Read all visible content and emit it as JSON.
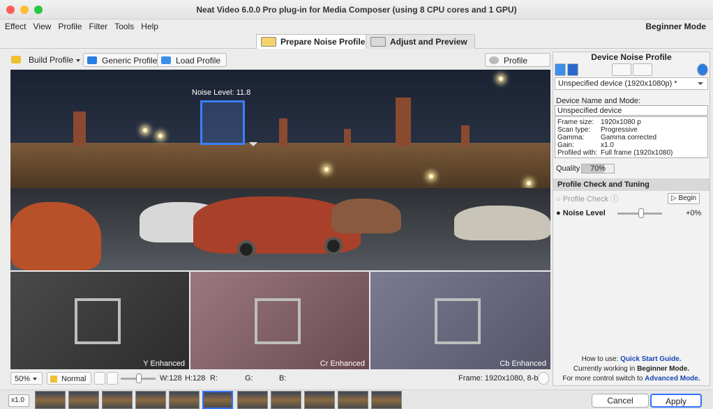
{
  "window": {
    "title": "Neat Video 6.0.0 Pro plug-in for Media Composer (using 8 CPU cores and 1 GPU)"
  },
  "menu": {
    "items": [
      "Effect",
      "View",
      "Profile",
      "Filter",
      "Tools",
      "Help"
    ],
    "mode": "Beginner Mode"
  },
  "tabs": {
    "prepare": "Prepare Noise Profile",
    "adjust": "Adjust and Preview"
  },
  "toolbar": {
    "build": "Build Profile",
    "generic": "Generic Profile",
    "load": "Load Profile",
    "check": "Profile Check"
  },
  "viewer": {
    "noise_label": "Noise Level: 11.8",
    "y_label": "Y Enhanced",
    "cr_label": "Cr Enhanced",
    "cb_label": "Cb Enhanced"
  },
  "status": {
    "zoom": "50%",
    "display": "Normal",
    "w": "W:128",
    "h": "H:128",
    "r": "R:",
    "g": "G:",
    "b": "B:",
    "frame": "Frame: 1920x1080, 8-bit"
  },
  "panel": {
    "title": "Device Noise Profile",
    "device": "Unspecified device (1920x1080p) *",
    "name_mode_label": "Device Name and Mode:",
    "device_name": "Unspecified device",
    "info": {
      "frame_size_k": "Frame size:",
      "frame_size_v": "1920x1080 p",
      "scan_k": "Scan type:",
      "scan_v": "Progressive",
      "gamma_k": "Gamma:",
      "gamma_v": "Gamma corrected",
      "gain_k": "Gain:",
      "gain_v": "x1.0",
      "profiled_k": "Profiled with:",
      "profiled_v": "Full frame (1920x1080)"
    },
    "quality_label": "Quality",
    "quality_value": "70%",
    "check_tuning_title": "Profile Check and Tuning",
    "profile_check_label": "Profile Check",
    "begin": "Begin",
    "noise_level_label": "Noise Level",
    "noise_level_value": "+0%",
    "help_line1_pre": "How to use: ",
    "help_line1_link": "Quick Start Guide.",
    "help_line2_pre": "Currently working in ",
    "help_line2_bold": "Beginner Mode.",
    "help_line3_pre": "For more control switch to ",
    "help_line3_link": "Advanced Mode."
  },
  "bottom": {
    "zoom": "x1.0",
    "cancel": "Cancel",
    "apply": "Apply"
  },
  "colors": {
    "accent": "#2f72ff",
    "noise_box": "#3d7fff",
    "link": "#1a45b5"
  }
}
